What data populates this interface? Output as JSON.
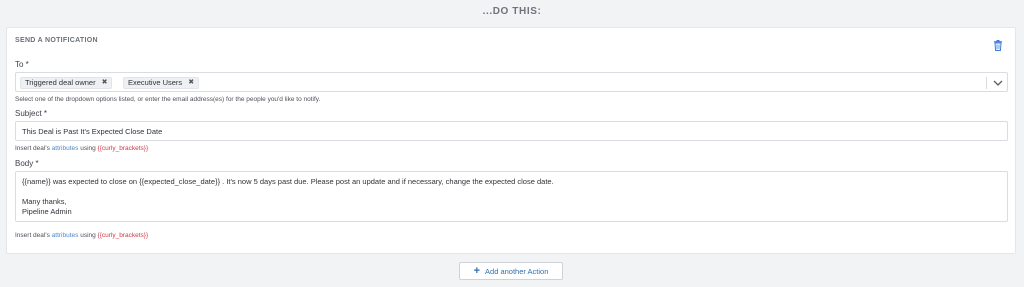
{
  "section_heading": "...DO THIS:",
  "card": {
    "title": "SEND A NOTIFICATION",
    "to": {
      "label": "To *",
      "tags": [
        {
          "label": "Triggered deal owner",
          "remove": "✖"
        },
        {
          "label": "Executive Users",
          "remove": "✖"
        }
      ],
      "help": "Select one of the dropdown options listed, or enter the email address(es) for the people you'd like to notify."
    },
    "subject": {
      "label": "Subject *",
      "value": "This Deal is Past It's Expected Close Date",
      "help_prefix": "Insert deal's ",
      "help_link1": "attributes",
      "help_middle": " using ",
      "help_link2": "{{curly_brackets}}"
    },
    "body": {
      "label": "Body *",
      "lines": [
        "{{name}} was expected to close on {{expected_close_date}} . It's now 5 days past due. Please post an update and if necessary, change the expected close date.",
        "",
        "Many thanks,",
        "Pipeline Admin"
      ],
      "help_prefix": "Insert deal's ",
      "help_link1": "attributes",
      "help_middle": " using ",
      "help_link2": "{{curly_brackets}}"
    }
  },
  "add_action_label": "Add another Action",
  "icons": {
    "trash": "trash-icon",
    "dropdown": "chevron-down-icon",
    "plus": "plus-icon"
  },
  "colors": {
    "link_blue": "#4f88c6",
    "link_red": "#d0384b",
    "trash_blue": "#3b7dd8",
    "button_text": "#2f6fb3"
  }
}
